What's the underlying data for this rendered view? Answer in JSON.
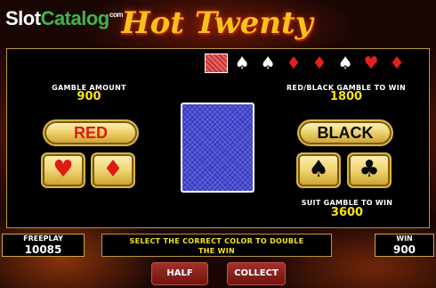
{
  "watermark": {
    "part1": "Slot",
    "part2": "Catalog",
    "suffix": "com"
  },
  "game": {
    "title": "Hot Twenty"
  },
  "history": [
    {
      "type": "back",
      "icon": "card-back-icon"
    },
    {
      "type": "black",
      "icon": "spade-icon",
      "glyph": "♠"
    },
    {
      "type": "black",
      "icon": "spade-icon",
      "glyph": "♠"
    },
    {
      "type": "red",
      "icon": "diamond-icon",
      "glyph": "♦"
    },
    {
      "type": "red",
      "icon": "diamond-icon",
      "glyph": "♦"
    },
    {
      "type": "black",
      "icon": "spade-icon",
      "glyph": "♠"
    },
    {
      "type": "red",
      "icon": "heart-icon",
      "glyph": "♥"
    },
    {
      "type": "red",
      "icon": "diamond-icon",
      "glyph": "♦"
    }
  ],
  "gamble": {
    "amount_label": "GAMBLE AMOUNT",
    "amount_value": "900",
    "redblack_label": "RED/BLACK GAMBLE TO WIN",
    "redblack_value": "1800",
    "suit_label": "SUIT GAMBLE TO WIN",
    "suit_value": "3600"
  },
  "buttons": {
    "red": "RED",
    "black": "BLACK",
    "heart": "♥",
    "diamond": "♦",
    "spade": "♠",
    "club": "♣",
    "half": "HALF",
    "collect": "COLLECT"
  },
  "status": {
    "freeplay_label": "FREEPLAY",
    "freeplay_value": "10085",
    "message_line1": "SELECT THE CORRECT COLOR TO DOUBLE",
    "message_line2": "THE WIN",
    "win_label": "WIN",
    "win_value": "900"
  },
  "colors": {
    "accent_gold": "#f5e31a",
    "suit_red": "#e01a12",
    "card_back": "#3a3cc6"
  }
}
